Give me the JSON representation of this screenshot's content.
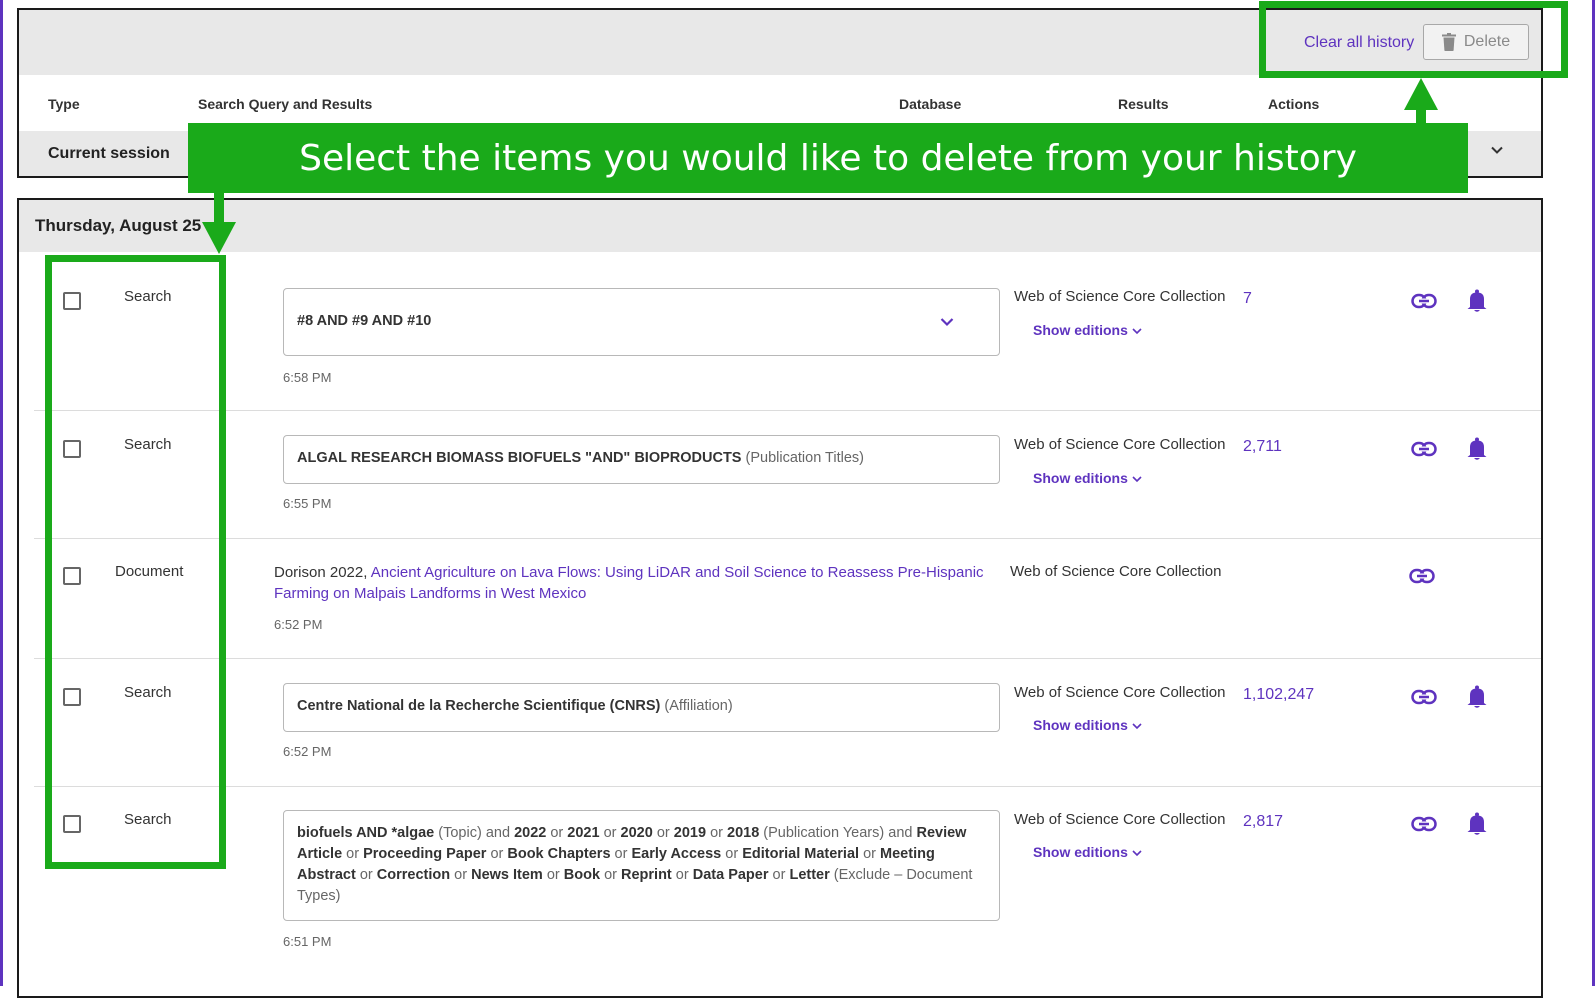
{
  "toolbar": {
    "clear_all_label": "Clear all history",
    "delete_label": "Delete"
  },
  "columns": {
    "type": "Type",
    "query": "Search Query and Results",
    "database": "Database",
    "results": "Results",
    "actions": "Actions"
  },
  "session": {
    "label": "Current session"
  },
  "history": {
    "date_label": "Thursday, August 25",
    "entries": [
      {
        "type": "Search",
        "query": "#8 AND #9 AND #10",
        "time": "6:58 PM",
        "database": "Web of Science Core Collection",
        "editions_label": "Show editions",
        "results": "7"
      },
      {
        "type": "Search",
        "query_bold": "ALGAL RESEARCH BIOMASS BIOFUELS \"AND\" BIOPRODUCTS",
        "query_meta": "(Publication Titles)",
        "time": "6:55 PM",
        "database": "Web of Science Core Collection",
        "editions_label": "Show editions",
        "results": "2,711"
      },
      {
        "type": "Document",
        "doc_author": "Dorison 2022,",
        "doc_title": "Ancient Agriculture on Lava Flows: Using LiDAR and Soil Science to Reassess Pre-Hispanic Farming on Malpais Landforms in West Mexico",
        "time": "6:52 PM",
        "database": "Web of Science Core Collection"
      },
      {
        "type": "Search",
        "query_bold": "Centre National de la Recherche Scientifique (CNRS)",
        "query_meta": "(Affiliation)",
        "time": "6:52 PM",
        "database": "Web of Science Core Collection",
        "editions_label": "Show editions",
        "results": "1,102,247"
      },
      {
        "type": "Search",
        "q": {
          "t1": "biofuels AND *algae",
          "m1": "(Topic)",
          "c1": "and",
          "t2": "2022",
          "o1": "or",
          "t3": "2021",
          "o2": "or",
          "t4": "2020",
          "o3": "or",
          "t5": "2019",
          "o4": "or",
          "t6": "2018",
          "m2": "(Publication Years)",
          "c2": "and",
          "t7": "Review Article",
          "o5": "or",
          "t8": "Proceeding Paper",
          "o6": "or",
          "t9": "Book Chapters",
          "o7": "or",
          "t10": "Early Access",
          "o8": "or",
          "t11": "Editorial Material",
          "o9": "or",
          "t12": "Meeting Abstract",
          "o10": "or",
          "t13": "Correction",
          "o11": "or",
          "t14": "News Item",
          "o12": "or",
          "t15": "Book",
          "o13": "or",
          "t16": "Reprint",
          "o14": "or",
          "t17": "Data Paper",
          "o15": "or",
          "t18": "Letter",
          "m3": "(Exclude – Document Types)"
        },
        "time": "6:51 PM",
        "database": "Web of Science Core Collection",
        "editions_label": "Show editions",
        "results": "2,817"
      }
    ]
  },
  "annotation": {
    "banner_text": "Select the items you would like to delete from your history",
    "color": "#1aaa1a"
  },
  "colors": {
    "accent": "#5e33bf",
    "header_bg": "#e8e8e8"
  },
  "icons": [
    "trash-icon",
    "chevron-down-icon",
    "link-icon",
    "bell-icon"
  ]
}
